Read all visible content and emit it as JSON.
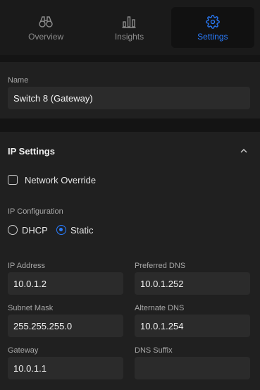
{
  "tabs": [
    {
      "label": "Overview",
      "icon": "binoculars-icon",
      "active": false
    },
    {
      "label": "Insights",
      "icon": "bar-chart-icon",
      "active": false
    },
    {
      "label": "Settings",
      "icon": "gear-icon",
      "active": true
    }
  ],
  "name_section": {
    "label": "Name",
    "value": "Switch 8 (Gateway)"
  },
  "ip_settings": {
    "title": "IP Settings",
    "collapse_icon": "chevron-up-icon",
    "network_override_label": "Network Override",
    "network_override_checked": false,
    "ip_config_label": "IP Configuration",
    "options": [
      {
        "label": "DHCP",
        "selected": false
      },
      {
        "label": "Static",
        "selected": true
      }
    ],
    "fields": {
      "ip_address": {
        "label": "IP Address",
        "value": "10.0.1.2"
      },
      "preferred_dns": {
        "label": "Preferred DNS",
        "value": "10.0.1.252"
      },
      "subnet_mask": {
        "label": "Subnet Mask",
        "value": "255.255.255.0"
      },
      "alternate_dns": {
        "label": "Alternate DNS",
        "value": "10.0.1.254"
      },
      "gateway": {
        "label": "Gateway",
        "value": "10.0.1.1"
      },
      "dns_suffix": {
        "label": "DNS Suffix",
        "value": ""
      }
    }
  },
  "colors": {
    "accent": "#2a7dff",
    "background": "#141414",
    "panel": "#202020",
    "input": "#2b2b2b"
  }
}
